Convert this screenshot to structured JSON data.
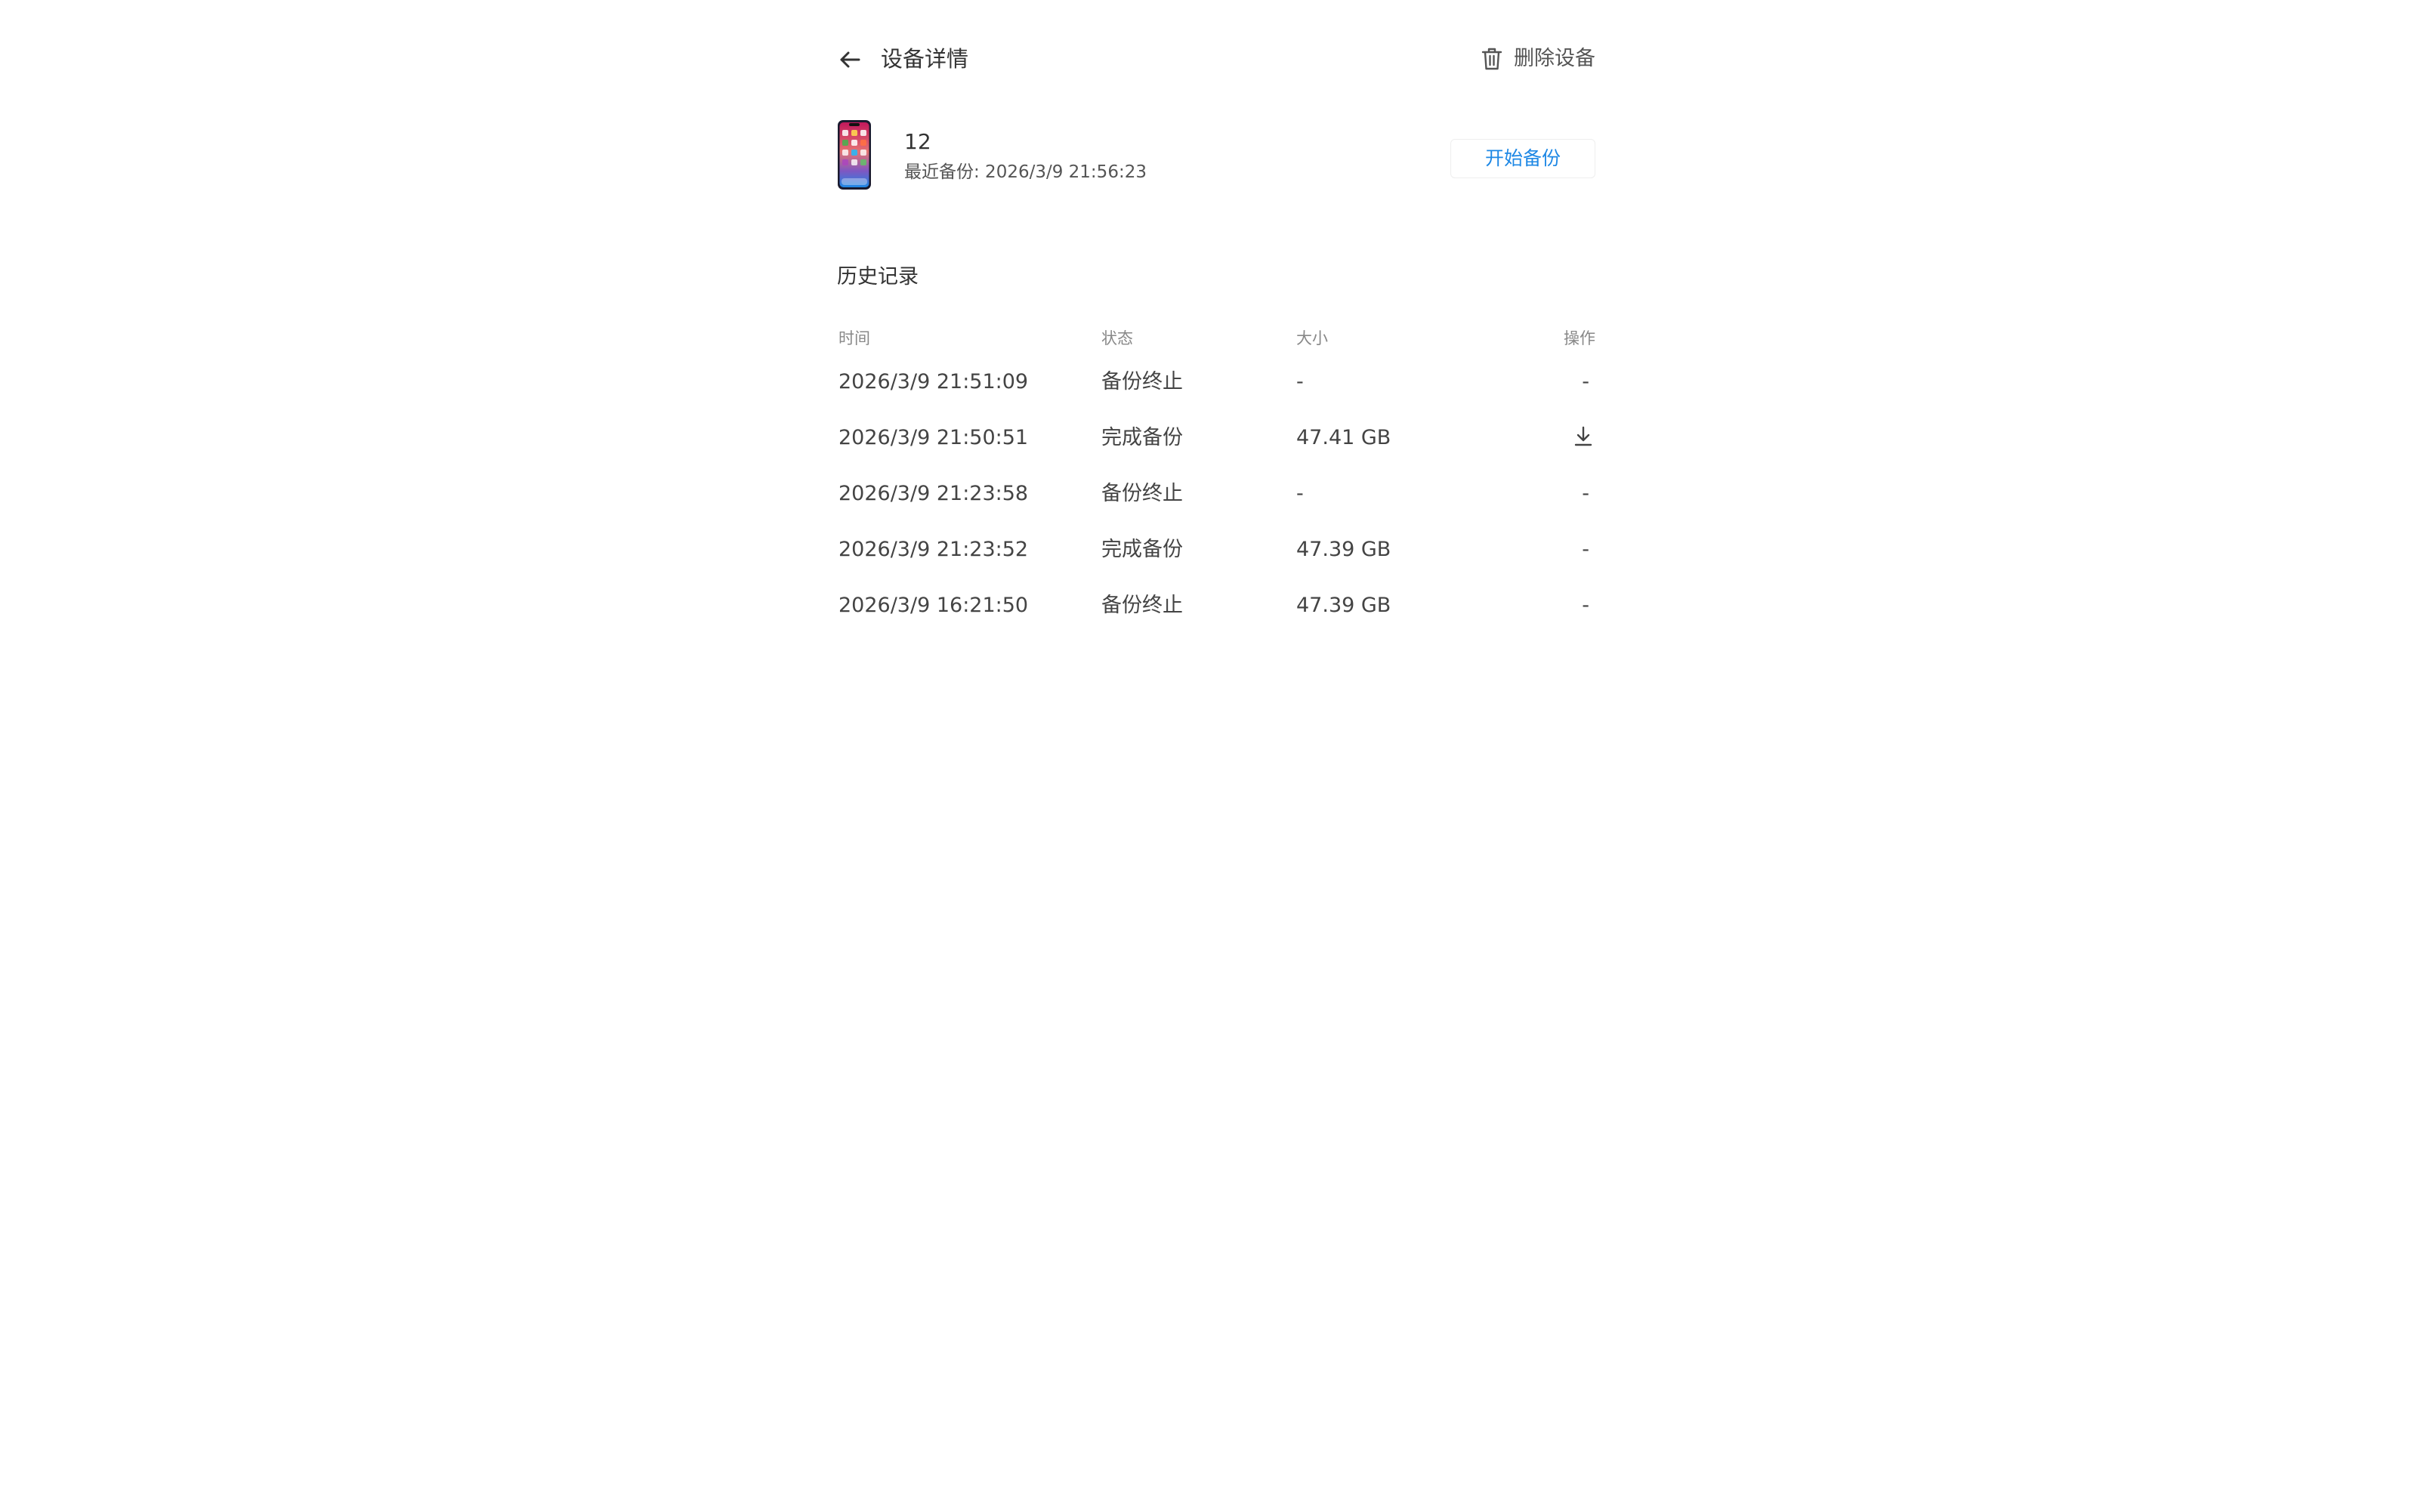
{
  "header": {
    "title": "设备详情",
    "delete_label": "删除设备",
    "icons": {
      "back": "arrow-left-icon",
      "delete": "trash-icon"
    }
  },
  "device": {
    "name": "12",
    "last_backup": "最近备份: 2026/3/9 21:56:23",
    "start_backup_label": "开始备份",
    "icon": "phone-icon"
  },
  "history": {
    "title": "历史记录",
    "columns": {
      "time": "时间",
      "status": "状态",
      "size": "大小",
      "action": "操作"
    },
    "rows": [
      {
        "time": "2026/3/9 21:51:09",
        "status": "备份终止",
        "size": "-",
        "action": "-"
      },
      {
        "time": "2026/3/9 21:50:51",
        "status": "完成备份",
        "size": "47.41 GB",
        "action": "download-icon"
      },
      {
        "time": "2026/3/9 21:23:58",
        "status": "备份终止",
        "size": "-",
        "action": "-"
      },
      {
        "time": "2026/3/9 21:23:52",
        "status": "完成备份",
        "size": "47.39 GB",
        "action": "-"
      },
      {
        "time": "2026/3/9 16:21:50",
        "status": "备份终止",
        "size": "47.39 GB",
        "action": "-"
      }
    ]
  },
  "colors": {
    "accent": "#1e88e5",
    "text": "#333333",
    "muted": "#888888"
  }
}
